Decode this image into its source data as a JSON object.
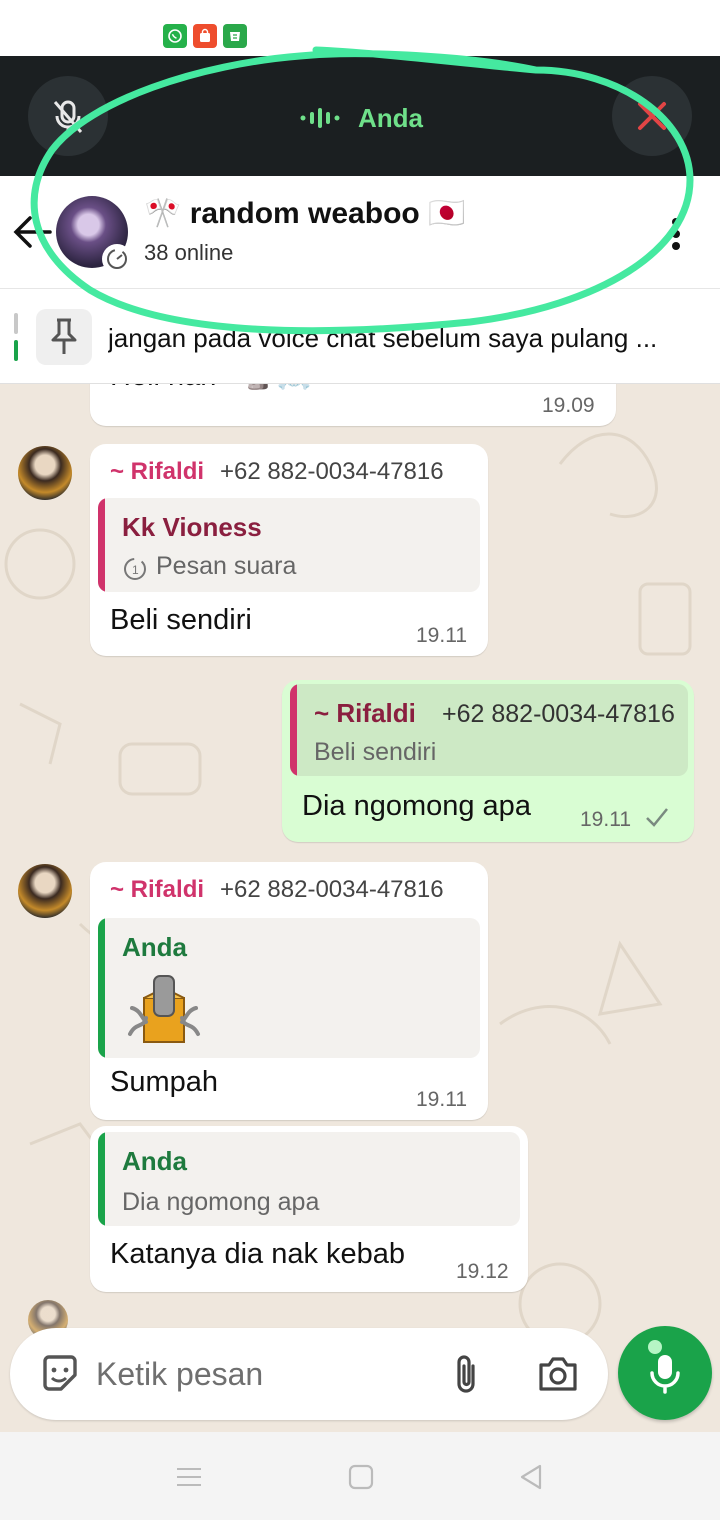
{
  "voice_chat": {
    "speaker": "Anda"
  },
  "group": {
    "name": "🎌 random weaboo 🇯🇵",
    "online": "38 online"
  },
  "pinned": {
    "text": "jangan pada voice chat sebelum saya pulang ..."
  },
  "messages": [
    {
      "partial_text": "Heli nan",
      "time": "19.09"
    },
    {
      "sender": "~ Rifaldi",
      "phone": "+62 882-0034-47816",
      "quote_name": "Kk Vioness",
      "quote_text": "Pesan suara",
      "text": "Beli sendiri",
      "time": "19.11"
    },
    {
      "quote_name": "~ Rifaldi",
      "quote_phone": "+62 882-0034-47816",
      "quote_text": "Beli sendiri",
      "text": "Dia ngomong apa",
      "time": "19.11"
    },
    {
      "sender": "~ Rifaldi",
      "phone": "+62 882-0034-47816",
      "quote_name": "Anda",
      "quote_icon": "moai-sticker-icon",
      "text": "Sumpah",
      "time": "19.11"
    },
    {
      "quote_name": "Anda",
      "quote_text": "Dia ngomong apa",
      "text": "Katanya dia nak kebab",
      "time": "19.12"
    }
  ],
  "composer": {
    "placeholder": "Ketik pesan"
  },
  "colors": {
    "accent_green": "#1aa34a",
    "sender_pink": "#d0336b",
    "quote_dark_red": "#8a1f3f",
    "quote_green": "#1e7a3e",
    "highlight_scribble": "#45e9a0",
    "outgoing_bubble": "#d9fdd3"
  }
}
